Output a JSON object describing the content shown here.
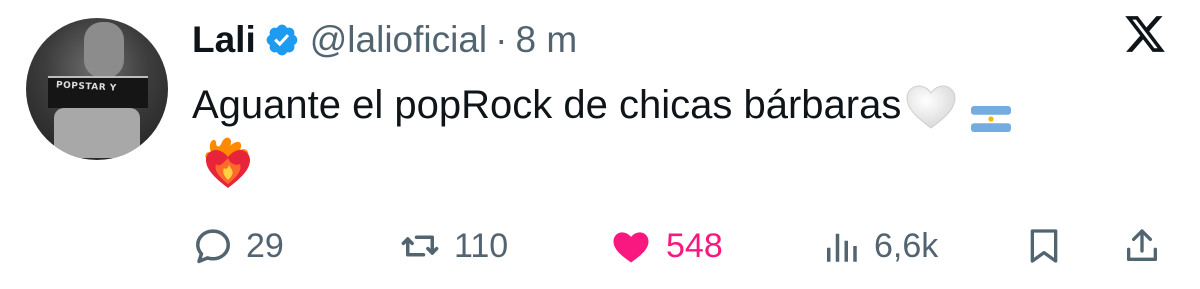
{
  "tweet": {
    "author_name": "Lali",
    "handle": "@lalioficial",
    "separator": "·",
    "time": "8 m",
    "text": "Aguante el popRock de chicas bárbaras",
    "avatar_shirt_text": "POPSTAR Y",
    "emojis": [
      "white-heart",
      "argentina-flag",
      "heart-on-fire"
    ]
  },
  "actions": {
    "replies": "29",
    "retweets": "110",
    "likes": "548",
    "views": "6,6k"
  },
  "colors": {
    "text": "#0f1419",
    "secondary": "#536471",
    "verified": "#1d9bf0",
    "like": "#f91880",
    "background": "#ffffff"
  },
  "icons": {
    "verified": "verified-badge-icon",
    "logo": "x-logo-icon",
    "reply": "reply-icon",
    "retweet": "retweet-icon",
    "like": "heart-filled-icon",
    "views": "views-chart-icon",
    "bookmark": "bookmark-icon",
    "share": "share-icon"
  }
}
